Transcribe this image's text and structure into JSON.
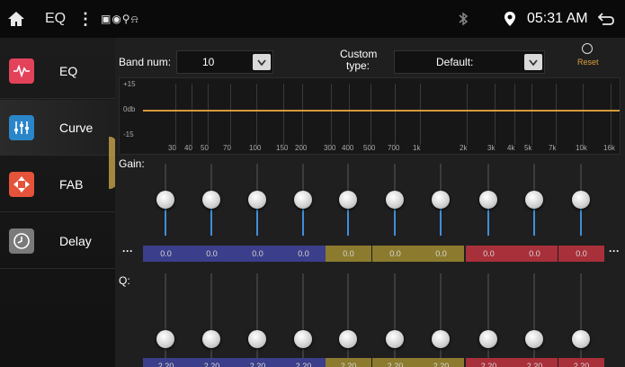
{
  "statusbar": {
    "home_icon": "home-icon",
    "app_title": "EQ",
    "menu_icon": "kebab-menu-icon",
    "sys_icons": "▣◉⚲⍾",
    "bluetooth_icon": "bluetooth-icon",
    "location_icon": "location-pin-icon",
    "time": "05:31 AM",
    "back_icon": "back-icon"
  },
  "sidebar": {
    "items": [
      {
        "label": "EQ",
        "icon": "eq-wave-icon",
        "color": "#e2425a",
        "active": false
      },
      {
        "label": "Curve",
        "icon": "sliders-icon",
        "color": "#2a86c9",
        "active": true
      },
      {
        "label": "FAB",
        "icon": "fader-balance-icon",
        "color": "#e4533a",
        "active": false
      },
      {
        "label": "Delay",
        "icon": "clock-icon",
        "color": "#7a7a7a",
        "active": false
      }
    ]
  },
  "controls": {
    "band_num_label": "Band num:",
    "band_num_value": "10",
    "custom_type_label_1": "Custom",
    "custom_type_label_2": "type:",
    "custom_type_value": "Default:",
    "reset_label": "Reset"
  },
  "graph": {
    "y_top": "+15",
    "y_mid": "0db",
    "y_bot": "-15",
    "freqs": [
      "30",
      "40",
      "50",
      "70",
      "100",
      "150",
      "200",
      "300",
      "400",
      "500",
      "700",
      "1k",
      "2k",
      "3k",
      "4k",
      "5k",
      "7k",
      "10k",
      "16k"
    ],
    "line_color": "#d39a3a"
  },
  "gain": {
    "label": "Gain:",
    "values": [
      "0.0",
      "0.0",
      "0.0",
      "0.0",
      "0.0",
      "0.0",
      "0.0",
      "0.0",
      "0.0",
      "0.0"
    ]
  },
  "q": {
    "label": "Q:",
    "values": [
      "2.20",
      "2.20",
      "2.20",
      "2.20",
      "2.20",
      "2.20",
      "2.20",
      "2.20",
      "2.20",
      "2.20"
    ]
  },
  "band_colors": [
    "#3b3e8a",
    "#3b3e8a",
    "#3b3e8a",
    "#3b3e8a",
    "#8c7b2e",
    "#8c7b2e",
    "#8c7b2e",
    "#a8303a",
    "#a8303a",
    "#a8303a"
  ],
  "more_label": "···"
}
